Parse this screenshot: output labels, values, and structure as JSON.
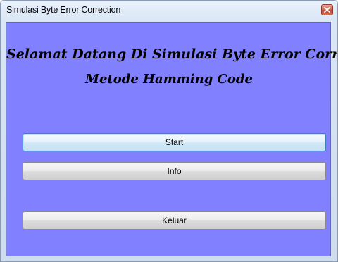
{
  "window": {
    "title": "Simulasi Byte Error Correction",
    "close_icon": "close-icon"
  },
  "main": {
    "heading_line1": "Selamat Datang Di Simulasi Byte Error Correction",
    "heading_line2": "Metode Hamming Code",
    "background_color": "#8181ff"
  },
  "buttons": {
    "start_label": "Start",
    "info_label": "Info",
    "exit_label": "Keluar"
  }
}
